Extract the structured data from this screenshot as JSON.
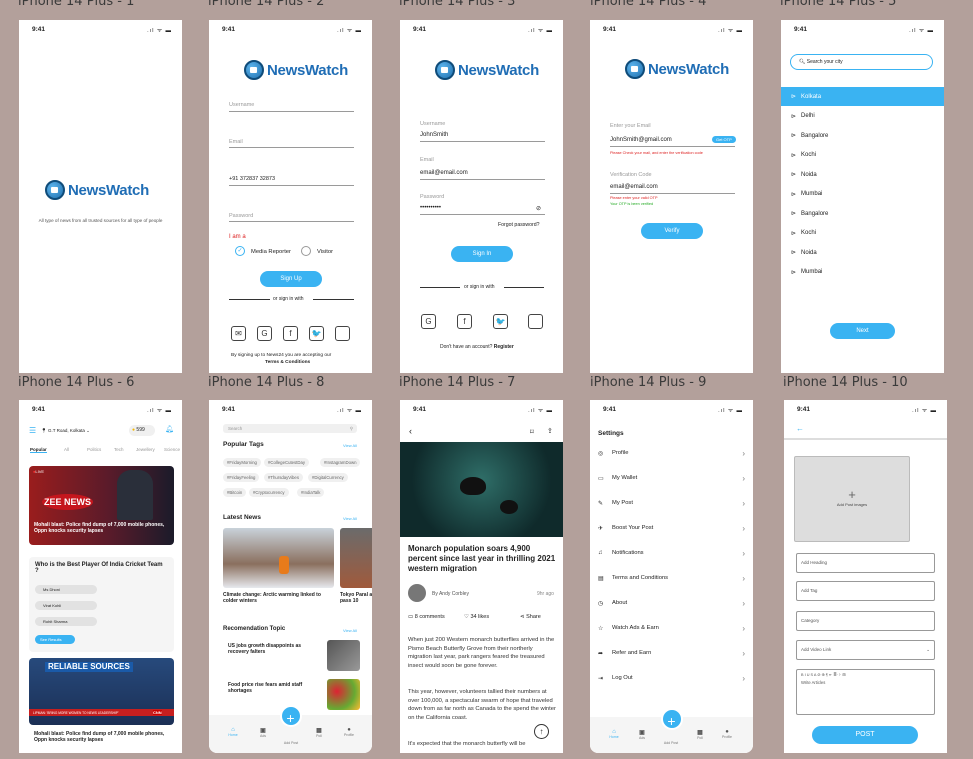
{
  "frames": [
    {
      "label": "iPhone 14 Plus - 1"
    },
    {
      "label": "iPhone 14 Plus - 2"
    },
    {
      "label": "iPhone 14 Plus - 3"
    },
    {
      "label": "iPhone 14 Plus - 4"
    },
    {
      "label": "iPhone 14 Plus - 5"
    },
    {
      "label": "iPhone 14 Plus - 6"
    },
    {
      "label": "iPhone 14 Plus - 8"
    },
    {
      "label": "iPhone 14 Plus - 7"
    },
    {
      "label": "iPhone 14 Plus - 9"
    },
    {
      "label": "iPhone 14 Plus - 10"
    }
  ],
  "status": {
    "time": "9:41",
    "icons": ".ıl ᯤ ▬"
  },
  "brand": {
    "name": "NewsWatch",
    "tagline": "All type of news from all trusted sources for all type of people"
  },
  "signup": {
    "username": "Username",
    "email": "Email",
    "phone": "+91 372837  32873",
    "password": "Password",
    "iam": "I am a",
    "media": "Media Reporter",
    "visitor": "Visitor",
    "button": "Sign Up",
    "or": "or sign in with",
    "terms1": "By signing up to News24 you are accepting our",
    "terms2": "Terms & Conditions"
  },
  "signin": {
    "username_label": "Username",
    "username_value": "JohnSmith",
    "email_label": "Email",
    "email_value": "email@email.com",
    "password_label": "Password",
    "password_value": "••••••••••",
    "forgot": "Forgot password?",
    "button": "Sign In",
    "or": "or sign in with",
    "no_account": "Don't have an account?",
    "register": "Register"
  },
  "verify": {
    "email_label": "Enter your Email",
    "email_value": "JohnSmith@gmail.com",
    "get_otp": "Get OTP",
    "email_hint": "Please Check your mail, and enter the verification code",
    "code_label": "Verification Code",
    "code_value": "email@email.com",
    "code_err": "Please enter your valid OTP",
    "code_ok": "Your OTP is been verified",
    "button": "Verify"
  },
  "city": {
    "placeholder": "Search your city",
    "cities": [
      "Kolkata",
      "Delhi",
      "Bangalore",
      "Kochi",
      "Noida",
      "Mumbai",
      "Bangalore",
      "Kochi",
      "Noida",
      "Mumbai"
    ],
    "next": "Next"
  },
  "home": {
    "location": "G.T Road, Kolkata",
    "coins": "599",
    "tabs": [
      "Popular",
      "All",
      "Politics",
      "Tech",
      "Jewellery",
      "Science"
    ],
    "live": "LIVE",
    "headline1": "Mohali blast: Police find dump of 7,000 mobile phones, Oppn knocks security lapses",
    "poll_q": "Who is the Best Player Of India Cricket Team ?",
    "options": [
      "Ms Dhoni",
      "Virat Kohli",
      "Rohit Sharma"
    ],
    "see_results": "See Results",
    "channel": "ZEE NEWS",
    "headline2": "Mohali blast: Police find dump of 7,000 mobile phones, Oppn knocks security lapses",
    "video_title": "RELIABLE SOURCES",
    "cnn": "CNN",
    "video_banner": "LIPMAN: 'BRING MORE WOMEN TO NEWS LEADERSHIP'"
  },
  "explore": {
    "search": "Search",
    "popular_tags": "Popular Tags",
    "view_all": "View All",
    "tags": [
      "#FridayMorning",
      "#CollegeCutestDay",
      "#InstagramDown",
      "#FridayFeeling",
      "#ThursdayVibes",
      "#DigitalCurrency",
      "#Bitcoin",
      "#Cryptocurrency",
      "#IndiaTalk"
    ],
    "latest": "Latest News",
    "latest1": "Climate change: Arctic warming linked to colder winters",
    "latest2": "Tokyo Paral and pass 10",
    "rec": "Recomendation Topic",
    "rec1": "US jobs growth disappoints as recovery falters",
    "rec2": "Food price rise fears amid staff shortages"
  },
  "article": {
    "title": "Monarch population soars 4,900 percent since last year in thrilling 2021 western migration",
    "author": "By Andy Corbley",
    "time": "9hr ago",
    "comments": "8 comments",
    "likes": "34 likes",
    "share": "Share",
    "p1": "When just 200 Western monarch butterflies arrived in the Pismo Beach Butterfly Grove from their northerly migration last year, park rangers feared the treasured insect would soon be gone forever.",
    "p2": "This year, however, volunteers tallied their numbers at over 100,000, a spectacular swarm of hope that traveled down from as far north as Canada to the spend the winter on the California coast.",
    "p3": "It's expected that the monarch butterfly will be"
  },
  "settings": {
    "title": "Settings",
    "items": [
      "Profile",
      "My Wallet",
      "My Post",
      "Boost Your Post",
      "Notifications",
      "Terms and Conditions",
      "About",
      "Watch Ads & Earn",
      "Refer and Earn",
      "Log Out"
    ],
    "nav": [
      "Home",
      "Ads",
      "Add Post",
      "Poll",
      "Profile"
    ]
  },
  "post": {
    "add_images": "Add Post images",
    "heading": "Add Heading",
    "tag": "Add Tag",
    "category": "Category",
    "video": "Add Video Link",
    "write": "Write Articles",
    "button": "POST",
    "toolbar": "B  I  U  S  A  ⊘  ⊕  ¶  ≡·  ≣·  ⁝·  ⊞"
  },
  "colors": {
    "accent": "#3ab3f2",
    "brand": "#1f6db5",
    "bg": "#b3a09b"
  }
}
